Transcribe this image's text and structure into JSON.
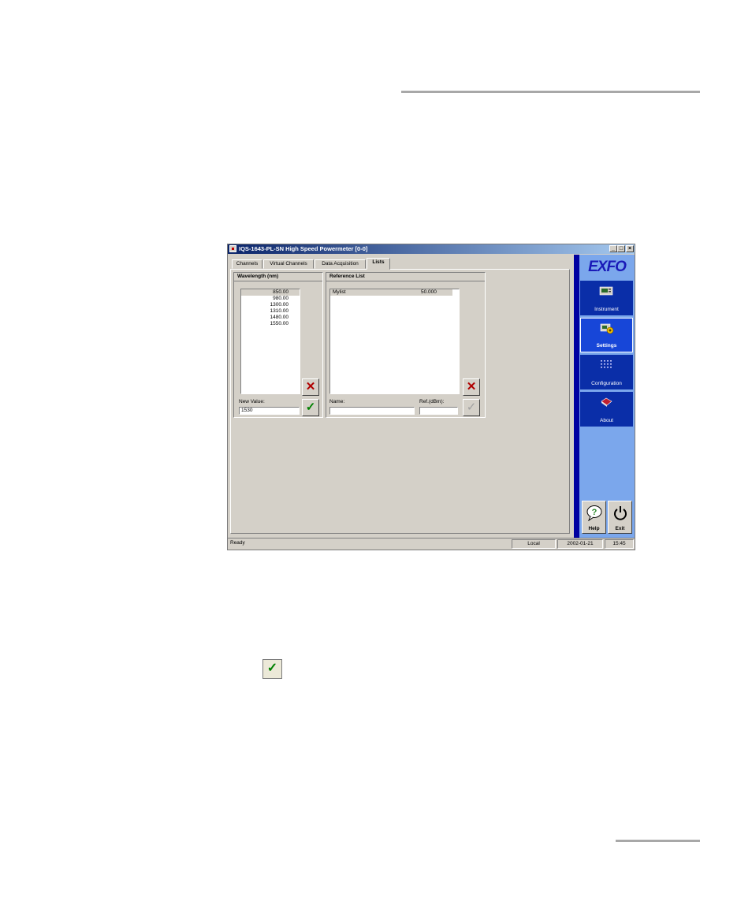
{
  "window": {
    "title": "IQS-1643-PL-SN High Speed Powermeter [0-0]",
    "controls": {
      "minimize": "_",
      "maximize": "□",
      "close": "×"
    }
  },
  "tabs": [
    {
      "label": "Channels",
      "active": false
    },
    {
      "label": "Virtual Channels",
      "active": false
    },
    {
      "label": "Data Acquisition",
      "active": false
    },
    {
      "label": "Lists",
      "active": true
    }
  ],
  "wavelength_panel": {
    "title": "Wavelength (nm)",
    "items": [
      "850.00",
      "980.00",
      "1300.00",
      "1310.00",
      "1480.00",
      "1550.00"
    ],
    "selected_index": 0,
    "new_value_label": "New Value:",
    "new_value": "1530"
  },
  "reference_panel": {
    "title": "Reference List",
    "items": [
      {
        "name": "Mylist",
        "value": "50.000"
      }
    ],
    "selected_index": 0,
    "name_label": "Name:",
    "name_value": "",
    "ref_label": "Ref.(dBm):",
    "ref_value": ""
  },
  "sidebar": {
    "logo": "EXFO",
    "items": [
      {
        "label": "Instrument",
        "icon": "instrument-icon",
        "active": false
      },
      {
        "label": "Settings",
        "icon": "settings-icon",
        "active": true
      },
      {
        "label": "Configuration",
        "icon": "configuration-icon",
        "active": false
      },
      {
        "label": "About",
        "icon": "about-book-icon",
        "active": false
      }
    ],
    "help_label": "Help",
    "exit_label": "Exit"
  },
  "statusbar": {
    "status": "Ready",
    "mode": "Local",
    "date": "2002-01-21",
    "time": "15:45"
  },
  "icons": {
    "delete": "✕",
    "apply": "✓"
  },
  "colors": {
    "nav_button": "#0a2ea8",
    "nav_active": "#1746d8",
    "sidebar_bg": "#7ba7ec",
    "delete_red": "#b00000",
    "apply_green": "#008000"
  }
}
